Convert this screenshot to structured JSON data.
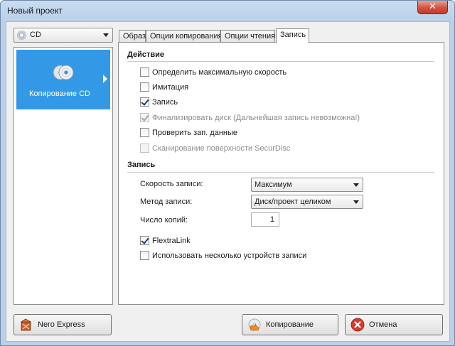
{
  "window": {
    "title": "Новый проект",
    "close_glyph": "✕"
  },
  "source": {
    "selected": "CD",
    "icon": "cd-icon"
  },
  "tasks": [
    {
      "label": "Копирование CD",
      "icon": "copy-disc-icon",
      "selected": true
    }
  ],
  "tabs": [
    {
      "label": "Образ",
      "active": false
    },
    {
      "label": "Опции копирования",
      "active": false
    },
    {
      "label": "Опции чтения",
      "active": false
    },
    {
      "label": "Запись",
      "active": true
    }
  ],
  "action_group": {
    "title": "Действие",
    "items": [
      {
        "label": "Определить максимальную скорость",
        "checked": false,
        "enabled": true
      },
      {
        "label": "Имитация",
        "checked": false,
        "enabled": true
      },
      {
        "label": "Запись",
        "checked": true,
        "enabled": true
      },
      {
        "label": "Финализировать диск (Дальнейшая запись невозможна!)",
        "checked": true,
        "enabled": false
      },
      {
        "label": "Проверить зап. данные",
        "checked": false,
        "enabled": true
      },
      {
        "label": "Сканирование поверхности SecurDisc",
        "checked": false,
        "enabled": false
      }
    ]
  },
  "write_group": {
    "title": "Запись",
    "speed_label": "Скорость записи:",
    "speed_value": "Максимум",
    "method_label": "Метод записи:",
    "method_value": "Диск/проект целиком",
    "copies_label": "Число копий:",
    "copies_value": "1",
    "options": [
      {
        "label": "FlextraLink",
        "checked": true
      },
      {
        "label": "Использовать несколько устройств записи",
        "checked": false
      }
    ]
  },
  "buttons": {
    "nero_express": "Nero Express",
    "copy": "Копирование",
    "cancel": "Отмена"
  },
  "colors": {
    "selection": "#3399e6",
    "title_bg": "#b9d0e8",
    "close": "#c43a26"
  }
}
